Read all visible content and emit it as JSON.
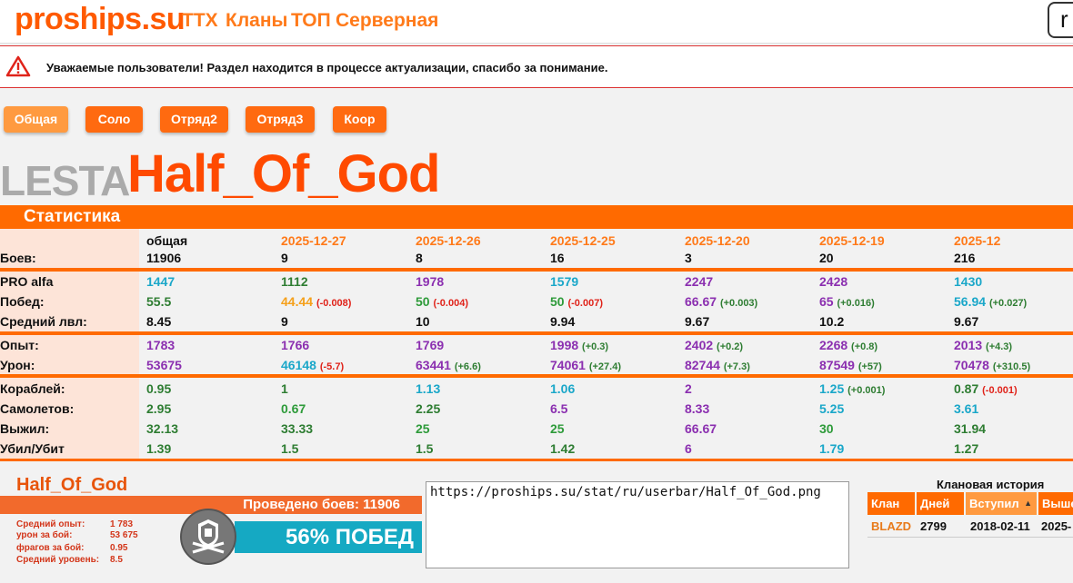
{
  "header": {
    "logo": "proships.su",
    "nav": [
      "ТТХ",
      "Кланы",
      "ТОП",
      "Серверная"
    ],
    "search_value": "r"
  },
  "notice": {
    "text": "Уважаемые пользователи! Раздел находится в процессе актуализации, спасибо за понимание."
  },
  "modes": [
    "Общая",
    "Соло",
    "Отряд2",
    "Отряд3",
    "Коор"
  ],
  "player": {
    "server": "LESTA",
    "name": "Half_Of_God"
  },
  "stats": {
    "section_title": "Статистика",
    "columns": [
      "общая",
      "2025-12-27",
      "2025-12-26",
      "2025-12-25",
      "2025-12-20",
      "2025-12-19",
      "2025-12"
    ],
    "labels": {
      "battles": "Боев:",
      "pr": "PRO alfa",
      "wins": "Побед:",
      "avg_level": "Средний лвл:",
      "exp": "Опыт:",
      "damage": "Урон:",
      "ships": "Кораблей:",
      "planes": "Самолетов:",
      "survived": "Выжил:",
      "kd": "Убил/Убит"
    },
    "battles": [
      "11906",
      "9",
      "8",
      "16",
      "3",
      "20",
      "216"
    ],
    "pr": [
      "1447",
      "1112",
      "1978",
      "1579",
      "2247",
      "2428",
      "1430"
    ],
    "wins": [
      "55.5",
      "44.44",
      "50",
      "50",
      "66.67",
      "65",
      "56.94"
    ],
    "wins_delta": [
      "",
      "(-0.008)",
      "(-0.004)",
      "(-0.007)",
      "(+0.003)",
      "(+0.016)",
      "(+0.027)"
    ],
    "avg_level": [
      "8.45",
      "9",
      "10",
      "9.94",
      "9.67",
      "10.2",
      "9.67"
    ],
    "exp": [
      "1783",
      "1766",
      "1769",
      "1998",
      "2402",
      "2268",
      "2013"
    ],
    "exp_delta": [
      "",
      "",
      "",
      "(+0.3)",
      "(+0.2)",
      "(+0.8)",
      "(+4.3)"
    ],
    "damage": [
      "53675",
      "46148",
      "63441",
      "74061",
      "82744",
      "87549",
      "70478"
    ],
    "damage_delta": [
      "",
      "(-5.7)",
      "(+6.6)",
      "(+27.4)",
      "(+7.3)",
      "(+57)",
      "(+310.5)"
    ],
    "ships": [
      "0.95",
      "1",
      "1.13",
      "1.06",
      "2",
      "1.25",
      "0.87"
    ],
    "ships_delta": [
      "",
      "",
      "",
      "",
      "",
      "(+0.001)",
      "(-0.001)"
    ],
    "planes": [
      "2.95",
      "0.67",
      "2.25",
      "6.5",
      "8.33",
      "5.25",
      "3.61"
    ],
    "survived": [
      "32.13",
      "33.33",
      "25",
      "25",
      "66.67",
      "30",
      "31.94"
    ],
    "kd": [
      "1.39",
      "1.5",
      "1.5",
      "1.42",
      "6",
      "1.79",
      "1.27"
    ]
  },
  "userbar": {
    "name": "Half_Of_God",
    "battles_text": "Проведено боев: 11906",
    "stat_labels": [
      "Средний опыт:",
      "урон за бой:",
      "фрагов за бой:",
      "Средний уровень:"
    ],
    "stat_values": [
      "1 783",
      "53 675",
      "0.95",
      "8.5"
    ],
    "win_text": "56% ПОБЕД",
    "url": "https://proships.su/stat/ru/userbar/Half_Of_God.png"
  },
  "clan_history": {
    "title": "Клановая история",
    "headers": [
      "Клан",
      "Дней",
      "Вступил",
      "Выше"
    ],
    "rows": [
      [
        "BLAZD",
        "2799",
        "2018-02-11",
        "2025-"
      ]
    ]
  },
  "colors": {
    "accent": "#ff6a00",
    "brand": "#ff5a00",
    "win_blue": "#15a9c3",
    "notice_border": "#dd3333"
  }
}
